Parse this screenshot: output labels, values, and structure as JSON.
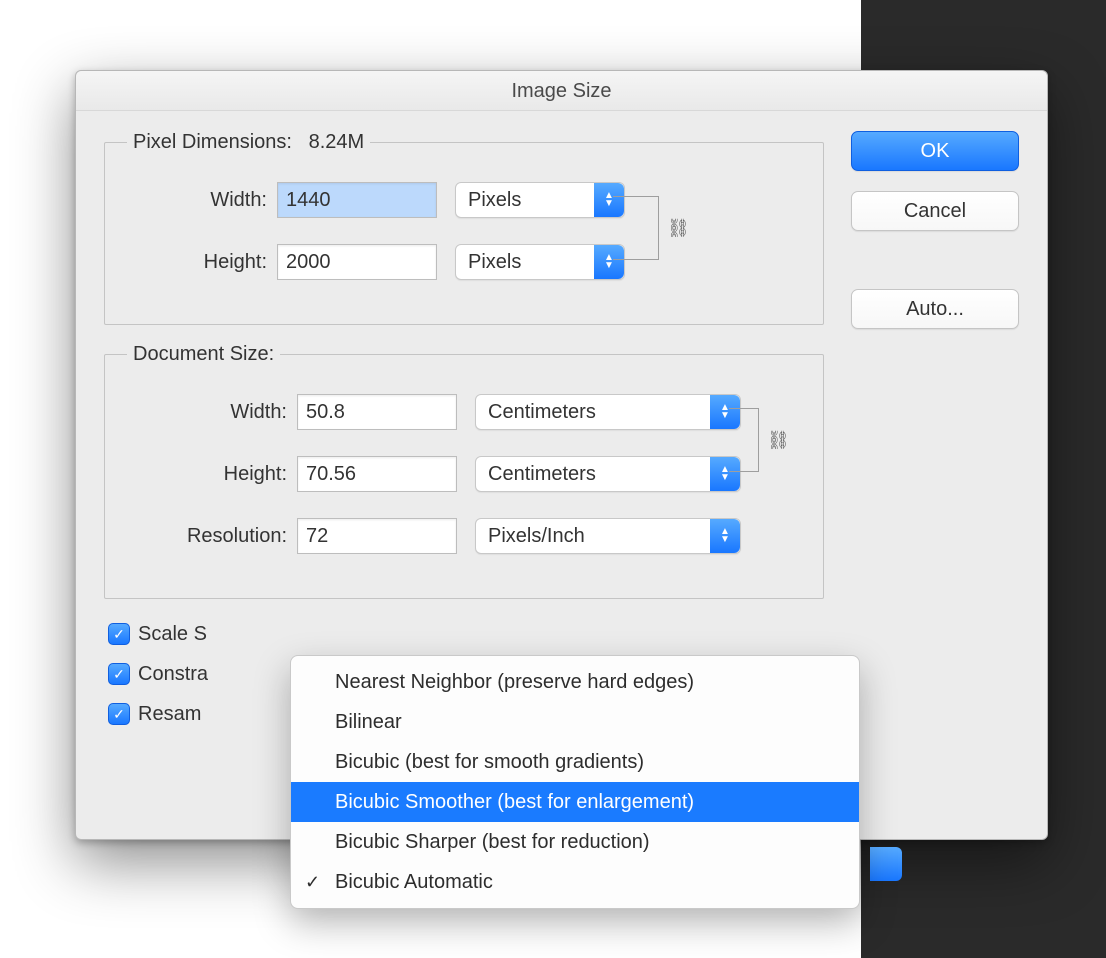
{
  "dialog": {
    "title": "Image Size"
  },
  "buttons": {
    "ok": "OK",
    "cancel": "Cancel",
    "auto": "Auto..."
  },
  "pixel_dimensions": {
    "legend_label": "Pixel Dimensions:",
    "legend_size": "8.24M",
    "width_label": "Width:",
    "width_value": "1440",
    "width_unit": "Pixels",
    "height_label": "Height:",
    "height_value": "2000",
    "height_unit": "Pixels"
  },
  "document_size": {
    "legend": "Document Size:",
    "width_label": "Width:",
    "width_value": "50.8",
    "width_unit": "Centimeters",
    "height_label": "Height:",
    "height_value": "70.56",
    "height_unit": "Centimeters",
    "resolution_label": "Resolution:",
    "resolution_value": "72",
    "resolution_unit": "Pixels/Inch"
  },
  "checkboxes": {
    "scale": {
      "label": "Scale Styles",
      "partial": "Scale S",
      "checked": true
    },
    "constrain": {
      "label": "Constrain Proportions",
      "partial": "Constra",
      "checked": true
    },
    "resample": {
      "label": "Resample Image:",
      "partial": "Resam",
      "checked": true
    }
  },
  "resample_menu": {
    "items": [
      "Nearest Neighbor (preserve hard edges)",
      "Bilinear",
      "Bicubic (best for smooth gradients)",
      "Bicubic Smoother (best for enlargement)",
      "Bicubic Sharper (best for reduction)",
      "Bicubic Automatic"
    ],
    "highlighted_index": 3,
    "checked_index": 5
  }
}
